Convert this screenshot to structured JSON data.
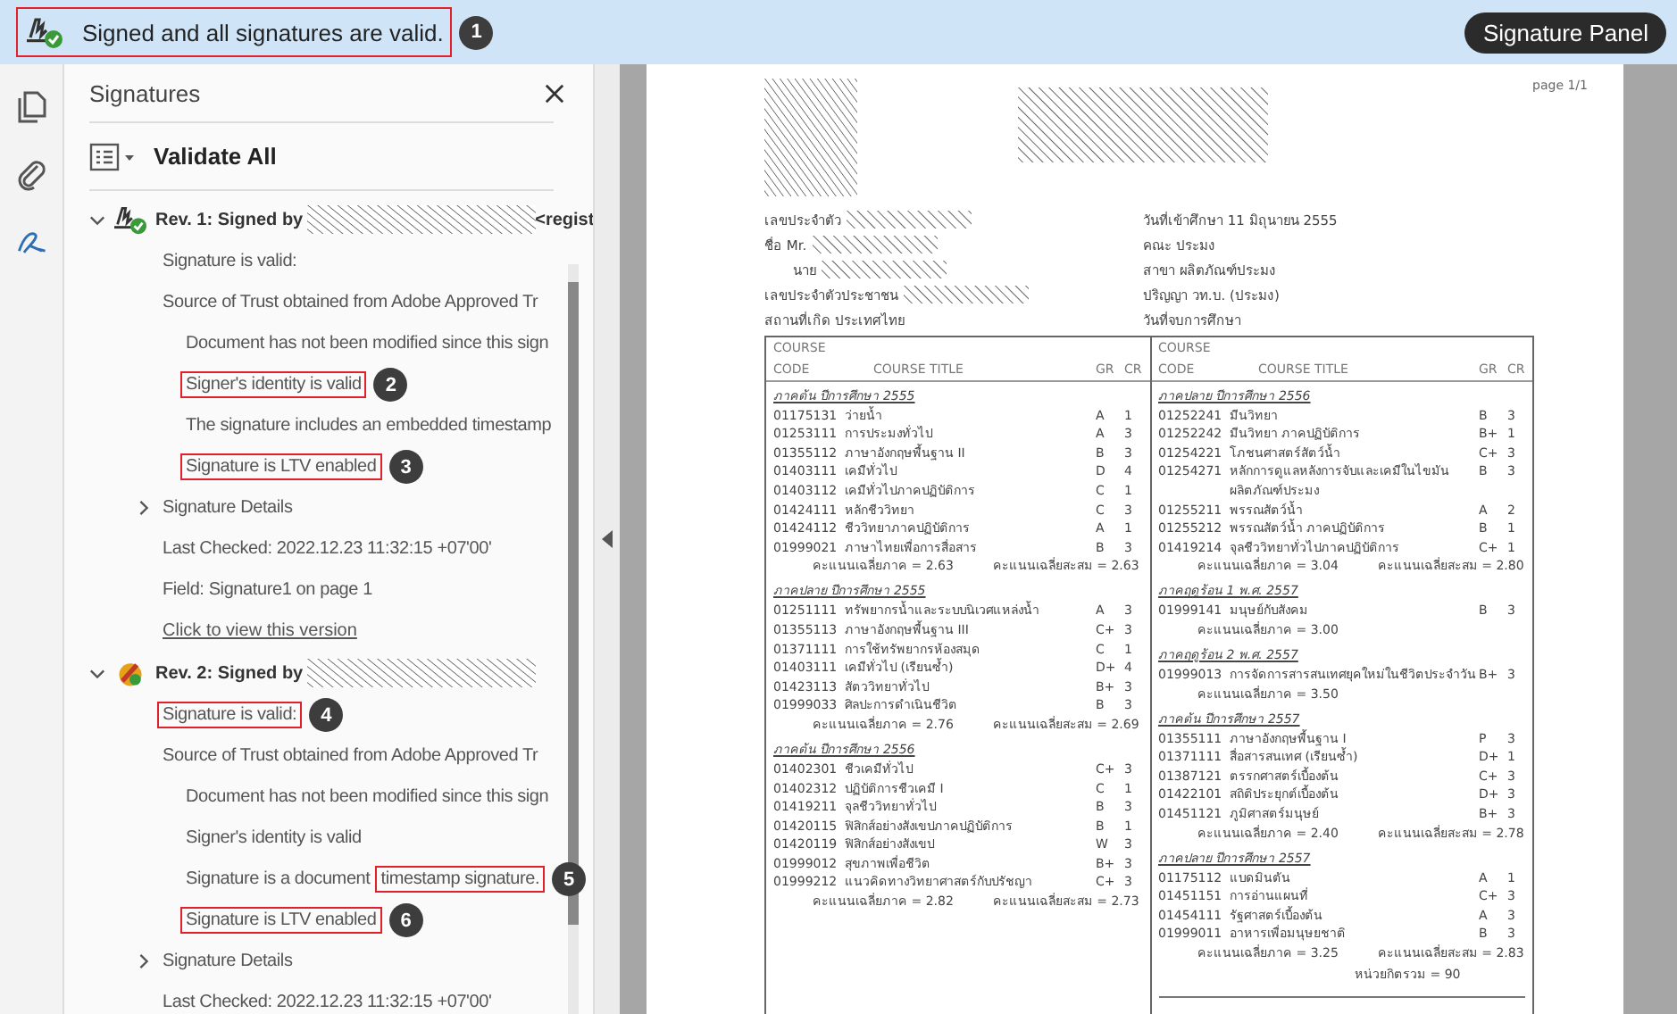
{
  "banner": {
    "text": "Signed and all signatures are valid.",
    "boxed": true,
    "callout": "1",
    "button": "Signature Panel"
  },
  "panel": {
    "title": "Signatures",
    "validate_label": "Validate All",
    "revisions": [
      {
        "kind": "valid",
        "title": "Rev. 1: Signed by",
        "suffix": "<regist",
        "expanded": true,
        "lines": [
          {
            "kind": "text",
            "text": "Signature is valid:",
            "boxed": false
          },
          {
            "kind": "text",
            "text": "Source of Trust obtained from Adobe Approved Tr",
            "boxed": false,
            "children": [
              {
                "parts": [
                  {
                    "text": "Document has not been modified since this sign",
                    "boxed": false
                  }
                ]
              },
              {
                "parts": [
                  {
                    "text": "Signer's identity is valid",
                    "boxed": true
                  }
                ],
                "callout": "2"
              },
              {
                "parts": [
                  {
                    "text": "The signature includes an embedded timestamp",
                    "boxed": false
                  }
                ]
              },
              {
                "parts": [
                  {
                    "text": "Signature is LTV enabled",
                    "boxed": true
                  }
                ],
                "callout": "3"
              }
            ]
          },
          {
            "kind": "toggle",
            "text": "Signature Details",
            "expanded": false
          },
          {
            "kind": "text",
            "text": "Last Checked: 2022.12.23 11:32:15 +07'00'",
            "boxed": false
          },
          {
            "kind": "text",
            "text": "Field: Signature1 on page 1",
            "boxed": false
          },
          {
            "kind": "link",
            "text": "Click to view this version"
          }
        ]
      },
      {
        "kind": "timestamp",
        "title": "Rev. 2: Signed by",
        "expanded": true,
        "lines": [
          {
            "kind": "text",
            "text": "Signature is valid:",
            "boxed": true,
            "callout": "4"
          },
          {
            "kind": "text",
            "text": "Source of Trust obtained from Adobe Approved Tr",
            "boxed": false,
            "children": [
              {
                "parts": [
                  {
                    "text": "Document has not been modified since this sign",
                    "boxed": false
                  }
                ]
              },
              {
                "parts": [
                  {
                    "text": "Signer's identity is valid",
                    "boxed": false
                  }
                ]
              },
              {
                "parts": [
                  {
                    "text": "Signature is a document",
                    "boxed": false
                  },
                  {
                    "text": "timestamp signature.",
                    "boxed": true
                  }
                ],
                "callout": "5"
              },
              {
                "parts": [
                  {
                    "text": "Signature is LTV enabled",
                    "boxed": true
                  }
                ],
                "callout": "6"
              }
            ]
          },
          {
            "kind": "toggle",
            "text": "Signature Details",
            "expanded": false
          },
          {
            "kind": "text",
            "text": "Last Checked: 2022.12.23 11:32:15 +07'00'",
            "boxed": false
          }
        ]
      }
    ]
  },
  "document": {
    "page_number": "page 1/1",
    "fields_left": [
      {
        "label": "เลขประจำตัว",
        "redacted": true
      },
      {
        "label": "ชื่อ  Mr.",
        "redacted": true
      },
      {
        "label": "นาย",
        "redacted": true
      },
      {
        "label": "เลขประจำตัวประชาชน",
        "redacted": true
      },
      {
        "label": "สถานที่เกิด  ประเทศไทย",
        "redacted": false
      }
    ],
    "fields_right": [
      {
        "label": "วันที่เข้าศึกษา  11 มิถุนายน 2555"
      },
      {
        "label": "คณะ  ประมง"
      },
      {
        "label": "สาขา  ผลิตภัณฑ์ประมง"
      },
      {
        "label": "ปริญญา  วท.บ. (ประมง)"
      },
      {
        "label": "วันที่จบการศึกษา"
      }
    ],
    "headers": [
      {
        "course": "COURSE",
        "code": "CODE",
        "title": "COURSE TITLE",
        "gr": "GR",
        "cr": "CR"
      },
      {
        "course": "COURSE",
        "code": "CODE",
        "title": "COURSE TITLE",
        "gr": "GR",
        "cr": "CR"
      }
    ],
    "columns": [
      {
        "semesters": [
          {
            "heading": "ภาคต้น ปีการศึกษา 2555",
            "rows": [
              [
                "01175131",
                "ว่ายน้ำ",
                "A",
                "1"
              ],
              [
                "01253111",
                "การประมงทั่วไป",
                "A",
                "3"
              ],
              [
                "01355112",
                "ภาษาอังกฤษพื้นฐาน II",
                "B",
                "3"
              ],
              [
                "01403111",
                "เคมีทั่วไป",
                "D",
                "4"
              ],
              [
                "01403112",
                "เคมีทั่วไปภาคปฏิบัติการ",
                "C",
                "1"
              ],
              [
                "01424111",
                "หลักชีววิทยา",
                "C",
                "3"
              ],
              [
                "01424112",
                "ชีววิทยาภาคปฏิบัติการ",
                "A",
                "1"
              ],
              [
                "01999021",
                "ภาษาไทยเพื่อการสื่อสาร",
                "B",
                "3"
              ]
            ],
            "gpa": "คะแนนเฉลี่ยภาค = 2.63",
            "gpax": "คะแนนเฉลี่ยสะสม = 2.63"
          },
          {
            "heading": "ภาคปลาย ปีการศึกษา 2555",
            "rows": [
              [
                "01251111",
                "ทรัพยากรน้ำและระบบนิเวศแหล่งน้ำ",
                "A",
                "3"
              ],
              [
                "01355113",
                "ภาษาอังกฤษพื้นฐาน III",
                "C+",
                "3"
              ],
              [
                "01371111",
                "การใช้ทรัพยากรห้องสมุด",
                "C",
                "1"
              ],
              [
                "01403111",
                "เคมีทั่วไป (เรียนซ้ำ)",
                "D+",
                "4"
              ],
              [
                "01423113",
                "สัตววิทยาทั่วไป",
                "B+",
                "3"
              ],
              [
                "01999033",
                "ศิลปะการดำเนินชีวิต",
                "B",
                "3"
              ]
            ],
            "gpa": "คะแนนเฉลี่ยภาค = 2.76",
            "gpax": "คะแนนเฉลี่ยสะสม = 2.69"
          },
          {
            "heading": "ภาคต้น ปีการศึกษา 2556",
            "rows": [
              [
                "01402301",
                "ชีวเคมีทั่วไป",
                "C+",
                "3"
              ],
              [
                "01402312",
                "ปฏิบัติการชีวเคมี I",
                "C",
                "1"
              ],
              [
                "01419211",
                "จุลชีววิทยาทั่วไป",
                "B",
                "3"
              ],
              [
                "01420115",
                "ฟิสิกส์อย่างสังเขปภาคปฏิบัติการ",
                "B",
                "1"
              ],
              [
                "01420119",
                "ฟิสิกส์อย่างสังเขป",
                "W",
                "3"
              ],
              [
                "01999012",
                "สุขภาพเพื่อชีวิต",
                "B+",
                "3"
              ],
              [
                "01999212",
                "แนวคิดทางวิทยาศาสตร์กับปรัชญา",
                "C+",
                "3"
              ]
            ],
            "gpa": "คะแนนเฉลี่ยภาค = 2.82",
            "gpax": "คะแนนเฉลี่ยสะสม = 2.73"
          }
        ]
      },
      {
        "semesters": [
          {
            "heading": "ภาคปลาย ปีการศึกษา 2556",
            "rows": [
              [
                "01252241",
                "มีนวิทยา",
                "B",
                "3"
              ],
              [
                "01252242",
                "มีนวิทยา ภาคปฏิบัติการ",
                "B+",
                "1"
              ],
              [
                "01254221",
                "โภชนศาสตร์สัตว์น้ำ",
                "C+",
                "3"
              ],
              [
                "01254271",
                "หลักการดูแลหลังการจับและเคมีในไขมัน ผลิตภัณฑ์ประมง",
                "B",
                "3"
              ],
              [
                "01255211",
                "พรรณสัตว์น้ำ",
                "A",
                "2"
              ],
              [
                "01255212",
                "พรรณสัตว์น้ำ ภาคปฏิบัติการ",
                "B",
                "1"
              ],
              [
                "01419214",
                "จุลชีววิทยาทั่วไปภาคปฏิบัติการ",
                "C+",
                "1"
              ]
            ],
            "gpa": "คะแนนเฉลี่ยภาค = 3.04",
            "gpax": "คะแนนเฉลี่ยสะสม = 2.80"
          },
          {
            "heading": "ภาคฤดูร้อน 1 พ.ศ. 2557",
            "rows": [
              [
                "01999141",
                "มนุษย์กับสังคม",
                "B",
                "3"
              ]
            ],
            "gpa": "คะแนนเฉลี่ยภาค = 3.00"
          },
          {
            "heading": "ภาคฤดูร้อน 2 พ.ศ. 2557",
            "rows": [
              [
                "01999013",
                "การจัดการสารสนเทศยุคใหม่ในชีวิตประจำวัน",
                "B+",
                "3"
              ]
            ],
            "gpa": "คะแนนเฉลี่ยภาค = 3.50"
          },
          {
            "heading": "ภาคต้น ปีการศึกษา 2557",
            "rows": [
              [
                "01355111",
                "ภาษาอังกฤษพื้นฐาน I",
                "P",
                "3"
              ],
              [
                "01371111",
                "สื่อสารสนเทศ (เรียนซ้ำ)",
                "D+",
                "1"
              ],
              [
                "01387121",
                "ตรรกศาสตร์เบื้องต้น",
                "C+",
                "3"
              ],
              [
                "01422101",
                "สถิติประยุกต์เบื้องต้น",
                "D+",
                "3"
              ],
              [
                "01451121",
                "ภูมิศาสตร์มนุษย์",
                "B+",
                "3"
              ]
            ],
            "gpa": "คะแนนเฉลี่ยภาค = 2.40",
            "gpax": "คะแนนเฉลี่ยสะสม = 2.78"
          },
          {
            "heading": "ภาคปลาย ปีการศึกษา 2557",
            "rows": [
              [
                "01175112",
                "แบดมินตัน",
                "A",
                "1"
              ],
              [
                "01451151",
                "การอ่านแผนที่",
                "C+",
                "3"
              ],
              [
                "01454111",
                "รัฐศาสตร์เบื้องต้น",
                "A",
                "3"
              ],
              [
                "01999011",
                "อาหารเพื่อมนุษยชาติ",
                "B",
                "3"
              ]
            ],
            "gpa": "คะแนนเฉลี่ยภาค = 3.25",
            "gpax": "คะแนนเฉลี่ยสะสม = 2.83"
          }
        ],
        "total": "หน่วยกิตรวม = 90"
      }
    ]
  }
}
